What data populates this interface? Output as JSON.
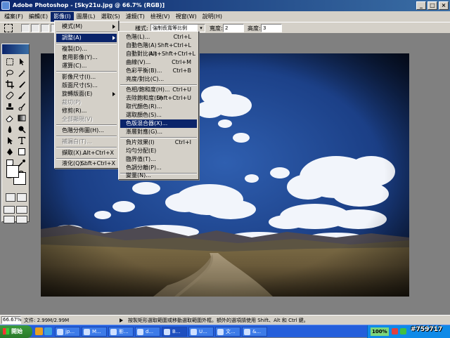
{
  "window": {
    "title": "Adobe Photoshop - [Sky21u.jpg @ 66.7% (RGB)]",
    "buttons": [
      "_",
      "□",
      "×"
    ]
  },
  "menubar": {
    "items": [
      "檔案(F)",
      "編輯(E)",
      "影像(I)",
      "圖層(L)",
      "選取(S)",
      "濾鏡(T)",
      "檢視(V)",
      "視窗(W)",
      "說明(H)"
    ]
  },
  "options": {
    "style_label": "樣式:",
    "style_value": "強制長寬等比例",
    "width_label": "寬度:",
    "width_value": "2",
    "height_label": "高度:",
    "height_value": "3"
  },
  "image_menu": {
    "items": [
      {
        "label": "模式(M)"
      },
      {
        "label": "調整(A)"
      },
      {
        "label": "複製(D)..."
      },
      {
        "label": "套用影像(Y)..."
      },
      {
        "label": "運算(C)..."
      },
      {
        "label": "影像尺寸(I)..."
      },
      {
        "label": "版面尺寸(S)..."
      },
      {
        "label": "旋轉版面(E)"
      },
      {
        "label": "裁切(P)"
      },
      {
        "label": "修剪(R)..."
      },
      {
        "label": "全部顯現(V)"
      },
      {
        "label": "色階分佈圖(H)..."
      },
      {
        "label": "補漏白(T)..."
      },
      {
        "label": "擷取(X)...",
        "shortcut": "Alt+Ctrl+X"
      },
      {
        "label": "液化(Q)...",
        "shortcut": "Shft+Ctrl+X"
      }
    ]
  },
  "adjust_menu": {
    "items": [
      {
        "label": "色階(L)...",
        "shortcut": "Ctrl+L"
      },
      {
        "label": "自動色階(A)",
        "shortcut": "Shft+Ctrl+L"
      },
      {
        "label": "自動對比(U)",
        "shortcut": "Alt+Shft+Ctrl+L"
      },
      {
        "label": "曲線(V)...",
        "shortcut": "Ctrl+M"
      },
      {
        "label": "色彩平衡(B)...",
        "shortcut": "Ctrl+B"
      },
      {
        "label": "亮度/對比(C)..."
      },
      {
        "label": "色相/飽和度(H)...",
        "shortcut": "Ctrl+U"
      },
      {
        "label": "去除飽和度(D)",
        "shortcut": "Shft+Ctrl+U"
      },
      {
        "label": "取代顏色(R)..."
      },
      {
        "label": "選取顏色(S)..."
      },
      {
        "label": "色版混合器(X)..."
      },
      {
        "label": "漸層對應(G)..."
      },
      {
        "label": "負片效果(I)",
        "shortcut": "Ctrl+I"
      },
      {
        "label": "均勻分配(E)"
      },
      {
        "label": "臨界值(T)..."
      },
      {
        "label": "色調分離(P)..."
      },
      {
        "label": "變量(N)..."
      }
    ]
  },
  "status": {
    "zoom": "66.67%",
    "doc": "文件: 2.99M/2.99M",
    "hint": "按製矩形選取範圍或移動選取範圍外框。額外的選項請使用 Shift、Alt 和 Ctrl 鍵。"
  },
  "taskbar": {
    "start": "開始",
    "tasks": [
      "jp...",
      "M...",
      "影...",
      "d...",
      "B...",
      "U...",
      "文...",
      "&..."
    ],
    "battery": "100%",
    "watermark": "#759717"
  },
  "colors": {
    "title_start": "#0a246a",
    "title_end": "#3a6ea5",
    "menu_bg": "#d4d0c8",
    "highlight": "#0a246a",
    "taskbar": "#245edb"
  },
  "icons": {
    "toolbox": [
      "marquee-icon",
      "move-icon",
      "lasso-icon",
      "magic-wand-icon",
      "crop-icon",
      "slice-icon",
      "healing-icon",
      "brush-icon",
      "stamp-icon",
      "history-brush-icon",
      "eraser-icon",
      "gradient-icon",
      "blur-icon",
      "dodge-icon",
      "path-select-icon",
      "type-icon",
      "pen-icon",
      "shape-icon",
      "notes-icon",
      "eyedropper-icon",
      "hand-icon",
      "zoom-icon"
    ]
  }
}
